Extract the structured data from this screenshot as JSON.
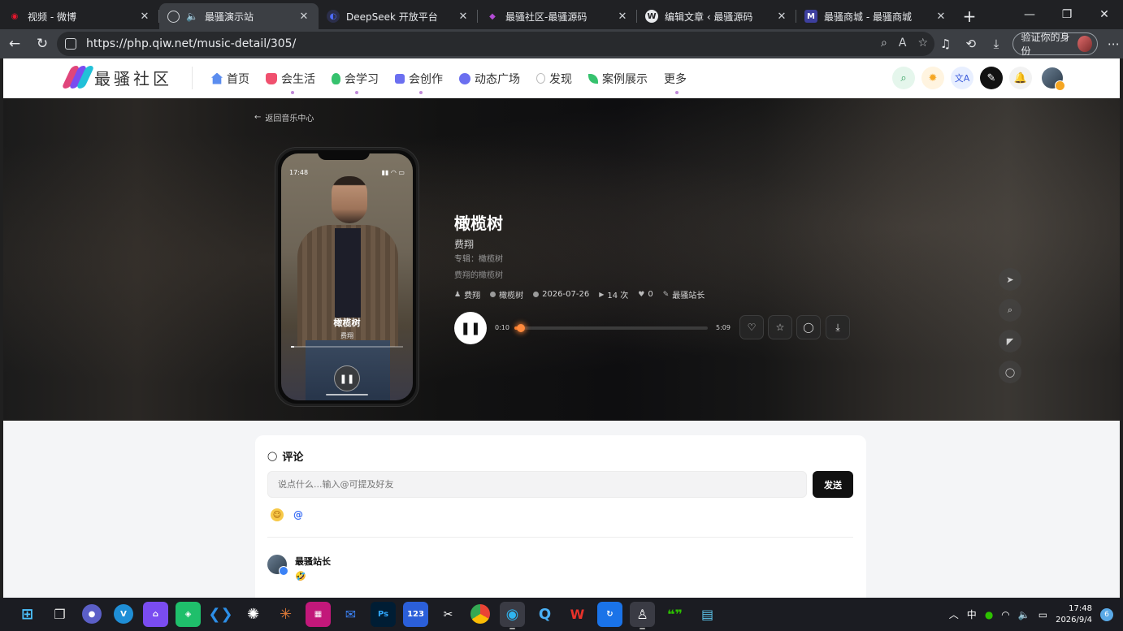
{
  "browser": {
    "tabs": [
      {
        "title": "视频 - 微博",
        "fav_color": "#e6162d",
        "fav_glyph": "◉",
        "active": false
      },
      {
        "title": "最骚演示站",
        "fav_color": "#5f6368",
        "fav_glyph": "🌐",
        "active": true,
        "audio": true
      },
      {
        "title": "DeepSeek 开放平台",
        "fav_color": "#4d6bfe",
        "fav_glyph": "◐",
        "active": false
      },
      {
        "title": "最骚社区-最骚源码",
        "fav_color": "#b44cd6",
        "fav_glyph": "◆",
        "active": false
      },
      {
        "title": "编辑文章 ‹ 最骚源码",
        "fav_color": "#ffffff",
        "fav_glyph": "W",
        "active": false
      },
      {
        "title": "最骚商城 - 最骚商城",
        "fav_color": "#3d3f9e",
        "fav_glyph": "M",
        "active": false
      }
    ],
    "url": "https://php.qiw.net/music-detail/305/",
    "verify_label": "验证你的身份"
  },
  "site": {
    "logo_text": "最骚社区",
    "nav": [
      {
        "label": "首页",
        "icon": "home-icon",
        "color": "#5b8def",
        "dot": false
      },
      {
        "label": "会生活",
        "icon": "cup-icon",
        "color": "#f0506e",
        "dot": true
      },
      {
        "label": "会学习",
        "icon": "bulb-icon",
        "color": "#36c26e",
        "dot": true
      },
      {
        "label": "会创作",
        "icon": "edit-icon",
        "color": "#6b6ff0",
        "dot": true
      },
      {
        "label": "动态广场",
        "icon": "planet-icon",
        "color": "#6b6ff0",
        "dot": false
      },
      {
        "label": "发现",
        "icon": "bulb-outline-icon",
        "color": "#bbbbbb",
        "dot": false
      },
      {
        "label": "案例展示",
        "icon": "sprout-icon",
        "color": "#36c26e",
        "dot": false
      },
      {
        "label": "更多",
        "icon": "",
        "color": "",
        "dot": true
      }
    ]
  },
  "hero": {
    "back_label": "返回音乐中心",
    "phone": {
      "time": "17:48",
      "title": "橄榄树",
      "artist": "费翔",
      "progress": 0.03
    },
    "song": {
      "title": "橄榄树",
      "artist": "费翔",
      "album_label": "专辑：橄榄树",
      "description": "费翔的橄榄树",
      "meta": {
        "artist": "费翔",
        "album": "橄榄树",
        "date": "2026-07-26",
        "plays": "14 次",
        "likes": "0",
        "uploader": "最骚站长"
      }
    },
    "player": {
      "current": "0:10",
      "duration": "5:09",
      "progress": 0.032
    }
  },
  "comments": {
    "title": "评论",
    "placeholder": "说点什么...输入@可提及好友",
    "send_label": "发送",
    "items": [
      {
        "name": "最骚站长",
        "text": "🤣"
      }
    ]
  },
  "taskbar": {
    "ime": "中",
    "time": "17:48",
    "date": "2026/9/4",
    "notif_count": "6"
  }
}
